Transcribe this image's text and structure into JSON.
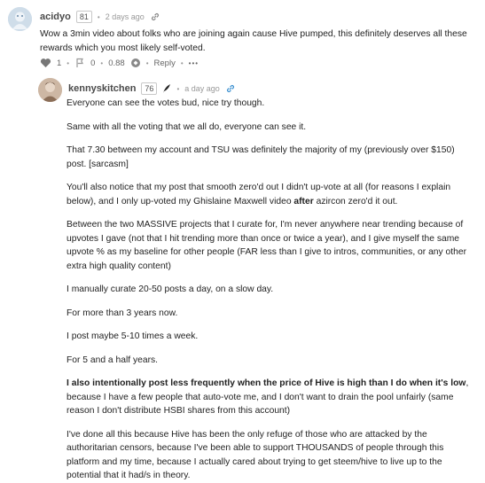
{
  "comment1": {
    "author": "acidyo",
    "reputation": "81",
    "separator": "•",
    "timestamp": "2 days ago",
    "body": "Wow a 3min video about folks who are joining again cause Hive pumped, this definitely deserves all these rewards which you most likely self-voted.",
    "actions": {
      "upvotes": "1",
      "downvotes": "0",
      "payout": "0.88",
      "reply_label": "Reply",
      "more_label": "•••"
    }
  },
  "comment2": {
    "author": "kennyskitchen",
    "reputation": "76",
    "separator": "•",
    "timestamp": "a day ago",
    "paragraphs": [
      {
        "text": "Everyone can see the votes bud, nice try though."
      },
      {
        "text": "Same with all the voting that we all do, everyone can see it."
      },
      {
        "text": "That 7.30 between my account and TSU was definitely the majority of my (previously over $150) post. [sarcasm]"
      },
      {
        "before": "You'll also notice that my post that smooth zero'd out I didn't up-vote at all (for reasons I explain below), and I only up-voted my Ghislaine Maxwell video ",
        "bold": "after",
        "after": " azircon zero'd it out."
      },
      {
        "text": "Between the two MASSIVE projects that I curate for, I'm never anywhere near trending because of upvotes I gave (not that I hit trending more than once or twice a year), and I give myself the same upvote % as my baseline for other people (FAR less than I give to intros, communities, or any other extra high quality content)"
      },
      {
        "text": "I manually curate 20-50 posts a day, on a slow day."
      },
      {
        "text": "For more than 3 years now."
      },
      {
        "text": "I post maybe 5-10 times a week."
      },
      {
        "text": "For 5 and a half years."
      },
      {
        "bold": "I also intentionally post less frequently when the price of Hive is high than I do when it's low",
        "after": ", because I have a few people that auto-vote me, and I don't want to drain the pool unfairly (same reason I don't distribute HSBI shares from this account)"
      },
      {
        "text": "I've done all this because Hive has been the only refuge of those who are attacked by the authoritarian censors, because I've been able to support THOUSANDS of people through this platform and my time, because I actually cared about trying to get steem/hive to live up to the potential that it had/s in theory."
      }
    ]
  },
  "colors": {
    "link_blue": "#1a9bd7",
    "vote_grey": "#777777",
    "author_text": "#4a4a4a"
  },
  "icons": [
    "avatar-acidyo",
    "link-icon",
    "heart-icon",
    "flag-icon",
    "coin-icon",
    "feather-icon",
    "avatar-kennyskitchen"
  ]
}
